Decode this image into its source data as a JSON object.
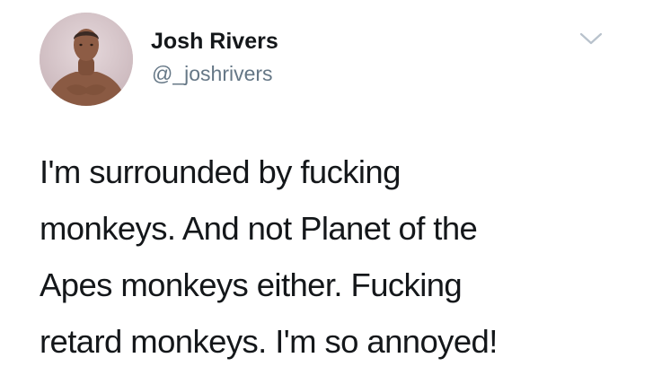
{
  "author": {
    "display_name": "Josh Rivers",
    "handle": "@_joshrivers",
    "avatar_icon": "profile-photo"
  },
  "menu": {
    "icon": "chevron-down-icon",
    "color": "#b8c2cc"
  },
  "tweet": {
    "lines": [
      "I'm surrounded by fucking",
      "monkeys. And not Planet of the",
      "Apes monkeys either. Fucking",
      "retard monkeys. I'm so annoyed!"
    ]
  },
  "colors": {
    "text": "#14171a",
    "secondary": "#657786",
    "background": "#ffffff"
  }
}
